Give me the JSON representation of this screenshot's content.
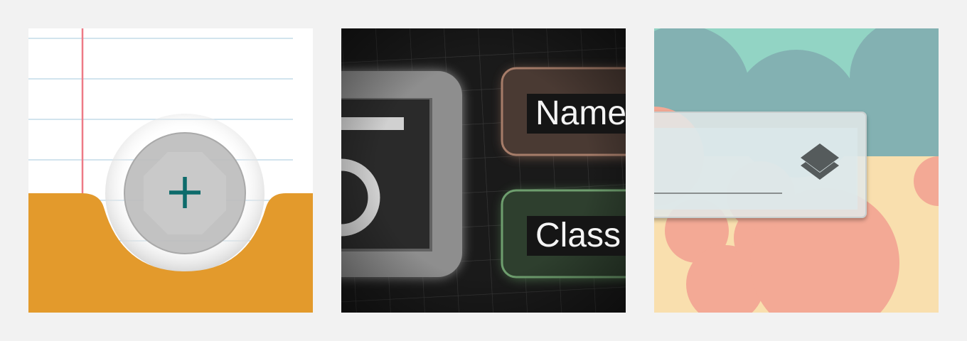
{
  "tiles": [
    {
      "icon": "plus-icon",
      "colors": {
        "folder": "#e39a2c",
        "button_ring": "#b5b5b5",
        "button_face": "#c4c4c4",
        "plus": "#0d6b6b",
        "margin_line": "#ee7a86",
        "ruled_line": "#b8d4e4"
      }
    },
    {
      "icon": "camera-icon",
      "labels": {
        "name": "Name",
        "class": "Class"
      },
      "colors": {
        "background": "#161616",
        "name_tag": "#4a3a33",
        "class_tag": "#2e3f2e",
        "grid": "#333333"
      }
    },
    {
      "icon": "layers-icon",
      "colors": {
        "sky": "#92d4c4",
        "cloud_teal": "#83b1b2",
        "cloud_salmon": "#f3a995",
        "sand": "#f9dfae",
        "panel": "#d8e7ea"
      }
    }
  ]
}
